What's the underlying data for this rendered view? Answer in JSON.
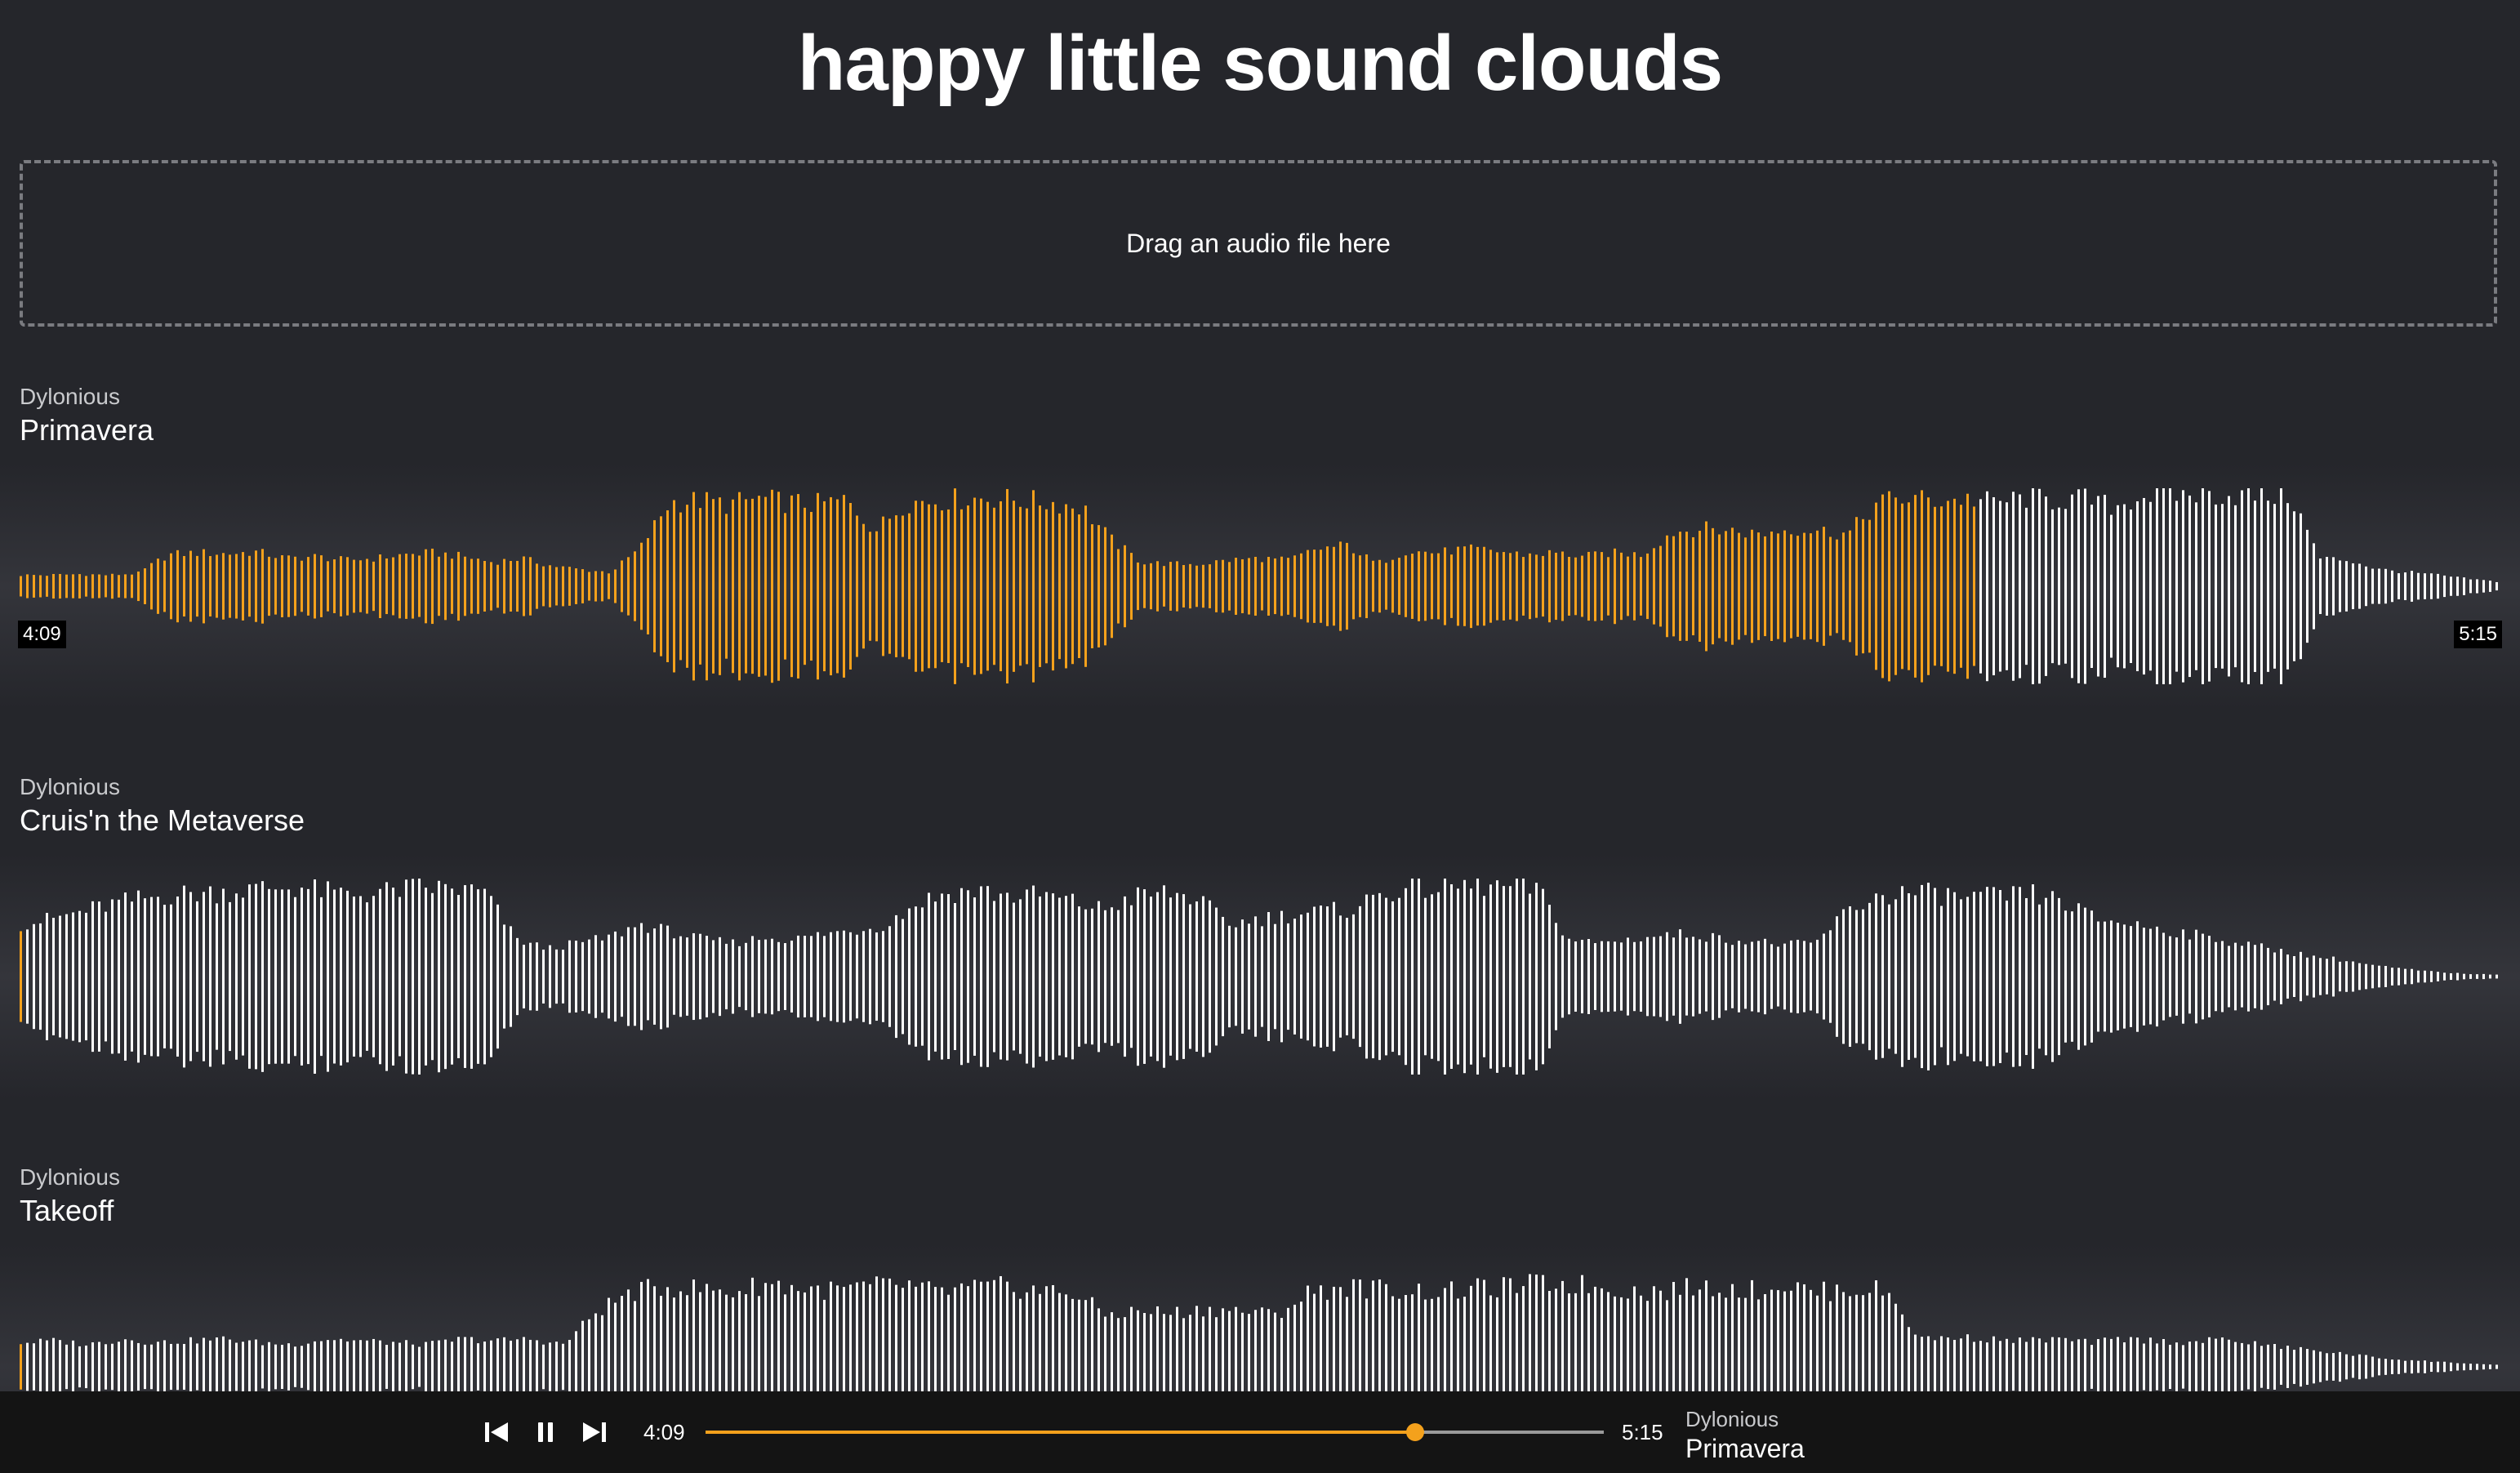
{
  "app": {
    "title": "happy little sound clouds"
  },
  "dropzone": {
    "label": "Drag an audio file here"
  },
  "colors": {
    "played": "#f4a11c",
    "unplayed": "#ffffff",
    "background": "#25262b"
  },
  "tracks": [
    {
      "artist": "Dylonious",
      "title": "Primavera",
      "current_time": "4:09",
      "duration": "5:15",
      "played_fraction": 0.79,
      "active": true,
      "levels": [
        0.12,
        0.12,
        0.13,
        0.12,
        0.14,
        0.34,
        0.36,
        0.35,
        0.37,
        0.3,
        0.32,
        0.28,
        0.3,
        0.34,
        0.36,
        0.32,
        0.26,
        0.3,
        0.22,
        0.18,
        0.15,
        0.4,
        0.9,
        0.92,
        0.88,
        0.94,
        0.9,
        0.88,
        0.92,
        0.6,
        0.9,
        0.92,
        0.94,
        0.95,
        0.92,
        0.9,
        0.85,
        0.5,
        0.26,
        0.24,
        0.24,
        0.28,
        0.3,
        0.28,
        0.4,
        0.44,
        0.24,
        0.38,
        0.36,
        0.4,
        0.38,
        0.34,
        0.36,
        0.32,
        0.36,
        0.34,
        0.58,
        0.62,
        0.6,
        0.56,
        0.62,
        0.6,
        0.56,
        0.9,
        0.95,
        0.92,
        0.94,
        0.9,
        0.95,
        0.92,
        0.94,
        0.85,
        0.98,
        0.98,
        0.99,
        0.98,
        0.97,
        0.98,
        0.3,
        0.28
      ],
      "fade_tail": [
        0.18,
        0.15,
        0.12,
        0.08,
        0.05
      ]
    },
    {
      "artist": "Dylonious",
      "title": "Cruis'n the Metaverse",
      "levels": [
        0.56,
        0.62,
        0.7,
        0.78,
        0.84,
        0.88,
        0.9,
        0.92,
        0.95,
        0.96,
        0.9,
        0.88,
        0.92,
        0.96,
        0.94,
        0.9,
        0.4,
        0.3,
        0.36,
        0.42,
        0.56,
        0.48,
        0.4,
        0.36,
        0.42,
        0.4,
        0.46,
        0.5,
        0.56,
        0.8,
        0.9,
        0.92,
        0.86,
        0.88,
        0.8,
        0.72,
        0.86,
        0.9,
        0.84,
        0.56,
        0.62,
        0.66,
        0.7,
        0.72,
        0.9,
        0.94,
        0.96,
        0.98,
        0.96,
        0.94,
        0.4,
        0.36,
        0.4,
        0.44,
        0.46,
        0.4,
        0.38,
        0.34,
        0.36,
        0.7,
        0.86,
        0.9,
        0.88,
        0.84,
        0.86,
        0.88,
        0.8,
        0.62,
        0.58,
        0.52,
        0.46,
        0.4,
        0.34,
        0.28,
        0.22,
        0.18
      ],
      "fade_tail": [
        0.12,
        0.08,
        0.05,
        0.03,
        0.02
      ]
    },
    {
      "artist": "Dylonious",
      "title": "Takeoff",
      "levels": [
        0.26,
        0.28,
        0.24,
        0.3,
        0.26,
        0.28,
        0.3,
        0.26,
        0.24,
        0.3,
        0.28,
        0.26,
        0.24,
        0.3,
        0.28,
        0.3,
        0.24,
        0.6,
        0.8,
        0.86,
        0.84,
        0.8,
        0.9,
        0.84,
        0.82,
        0.86,
        0.88,
        0.8,
        0.84,
        0.86,
        0.82,
        0.8,
        0.56,
        0.6,
        0.58,
        0.62,
        0.6,
        0.56,
        0.8,
        0.86,
        0.84,
        0.82,
        0.8,
        0.84,
        0.86,
        0.9,
        0.88,
        0.84,
        0.8,
        0.84,
        0.86,
        0.82,
        0.88,
        0.8,
        0.84,
        0.82,
        0.3,
        0.32,
        0.3,
        0.28,
        0.3,
        0.26,
        0.3,
        0.28,
        0.26,
        0.3,
        0.24,
        0.2,
        0.16,
        0.12
      ],
      "fade_tail": [
        0.08,
        0.06,
        0.04,
        0.02
      ]
    }
  ],
  "player": {
    "current_time": "4:09",
    "duration": "5:15",
    "progress": 0.79,
    "artist": "Dylonious",
    "title": "Primavera",
    "icons": {
      "prev": "skip-back-icon",
      "pause": "pause-icon",
      "next": "skip-forward-icon"
    }
  }
}
